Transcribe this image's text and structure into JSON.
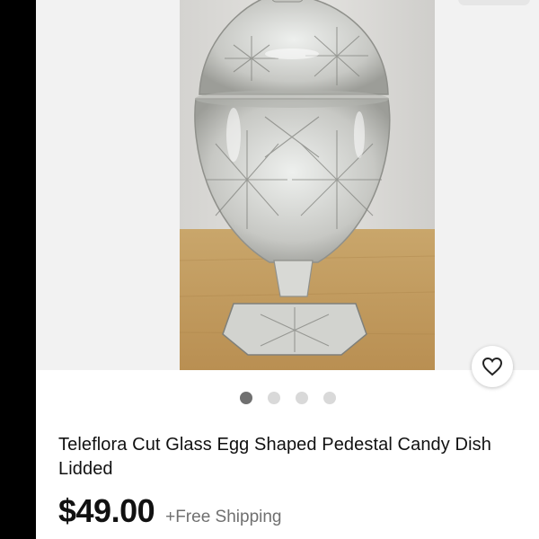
{
  "listing": {
    "title": "Teleflora Cut Glass Egg Shaped Pedestal Candy Dish Lidded",
    "price": "$49.00",
    "shipping": "+Free Shipping"
  },
  "gallery": {
    "image_count": 4,
    "active_index": 0
  },
  "icons": {
    "watch": "heart-outline-icon"
  },
  "colors": {
    "dot_active": "#707070",
    "dot_inactive": "#d9d9d9",
    "shipping_text": "#707070"
  }
}
